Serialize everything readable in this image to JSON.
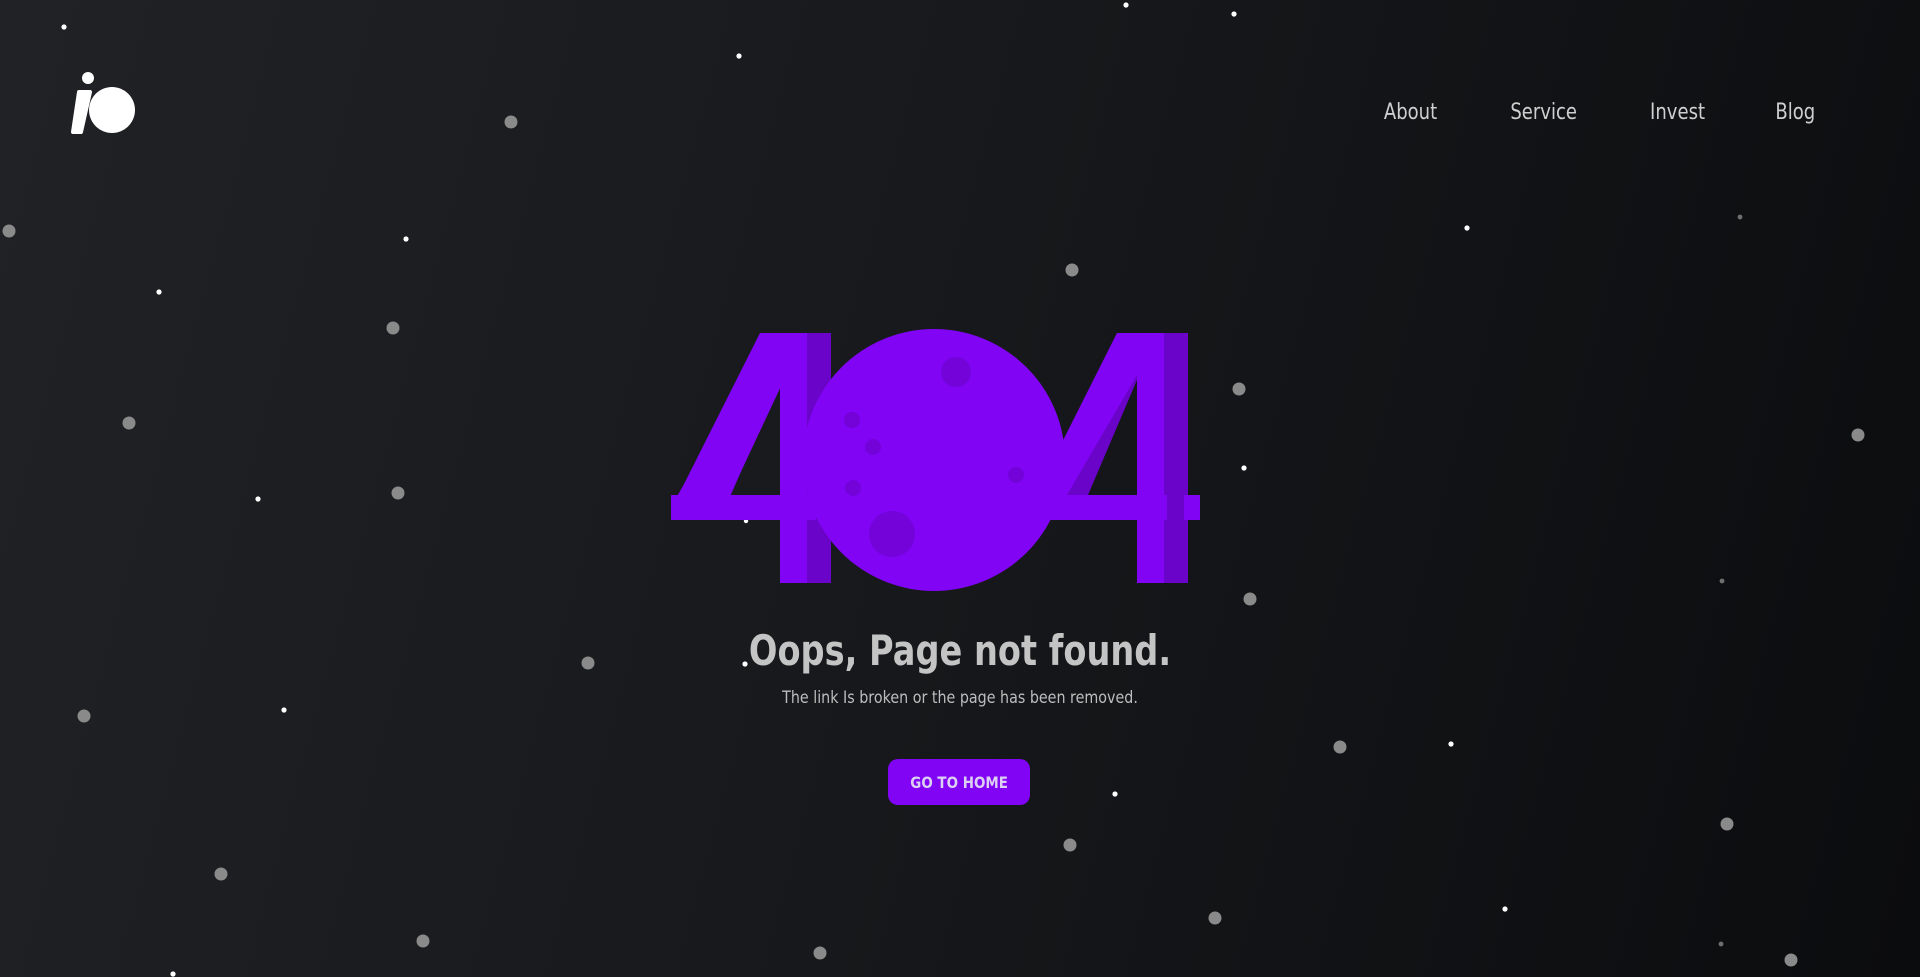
{
  "brand": {
    "logo_icon": "io-logo-icon"
  },
  "nav": {
    "items": [
      {
        "label": "About"
      },
      {
        "label": "Service"
      },
      {
        "label": "Invest"
      },
      {
        "label": "Blog"
      }
    ]
  },
  "error": {
    "code_left": "4",
    "code_middle_icon": "moon-icon",
    "code_right": "4",
    "title": "Oops, Page not found.",
    "message": "The link Is broken or the page has been removed.",
    "button_label": "GO TO HOME"
  },
  "colors": {
    "accent": "#8105f4",
    "accent_shadow": "#6a04c9",
    "background_light": "#202226",
    "background_dark": "#0b0c0e",
    "text": "#c9c9c9"
  },
  "background": {
    "decoration_icon": "stars-icon"
  }
}
